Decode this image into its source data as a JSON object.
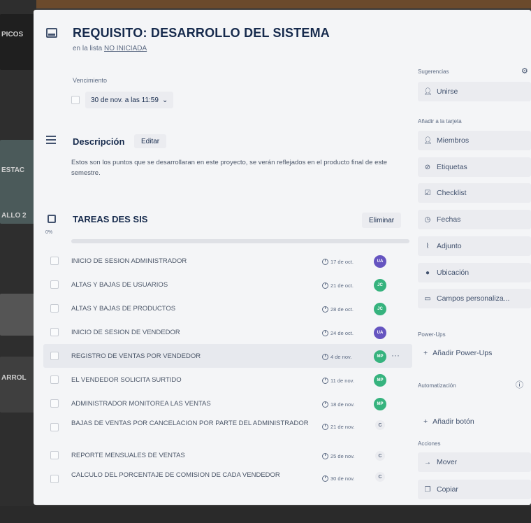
{
  "background": {
    "left_labels": [
      "PICOS",
      "ESTAC",
      "ALLO 2",
      "ARROL"
    ]
  },
  "card": {
    "title": "REQUISITO: DESARROLLO DEL SISTEMA",
    "in_list_prefix": "en la lista",
    "list_name": "NO INICIADA"
  },
  "due": {
    "label": "Vencimiento",
    "value": "30 de nov. a las 11:59",
    "chevron": "⌄"
  },
  "description": {
    "title": "Descripción",
    "edit_label": "Editar",
    "text": "Estos son los puntos que se desarrollaran en este proyecto, se verán reflejados en el producto final de este semestre."
  },
  "checklist": {
    "title": "TAREAS DES SIS",
    "delete_label": "Eliminar",
    "percent": "0%",
    "progress": 0,
    "items": [
      {
        "text": "INICIO DE SESION ADMINISTRADOR",
        "date": "17 de oct.",
        "avatar": "UA",
        "avatar_color": "#6554c0"
      },
      {
        "text": "ALTAS Y BAJAS DE USUARIOS",
        "date": "21 de oct.",
        "avatar": "JC",
        "avatar_color": "#36b37e"
      },
      {
        "text": "ALTAS Y BAJAS DE PRODUCTOS",
        "date": "28 de oct.",
        "avatar": "JC",
        "avatar_color": "#36b37e"
      },
      {
        "text": "INICIO DE SESION DE VENDEDOR",
        "date": "24 de oct.",
        "avatar": "UA",
        "avatar_color": "#6554c0"
      },
      {
        "text": "REGISTRO DE VENTAS POR VENDEDOR",
        "date": "4 de nov.",
        "avatar": "MP",
        "avatar_color": "#36b37e",
        "more": "···"
      },
      {
        "text": "EL VENDEDOR SOLICITA SURTIDO",
        "date": "11 de nov.",
        "avatar": "MP",
        "avatar_color": "#36b37e"
      },
      {
        "text": "ADMINISTRADOR MONITOREA LAS VENTAS",
        "date": "18 de nov.",
        "avatar": "MP",
        "avatar_color": "#36b37e"
      },
      {
        "text": "BAJAS DE VENTAS POR CANCELACION POR PARTE DEL ADMINISTRADOR",
        "date": "21 de nov.",
        "avatar": "C"
      },
      {
        "text": "REPORTE MENSUALES DE VENTAS",
        "date": "25 de nov.",
        "avatar": "C"
      },
      {
        "text": "CALCULO DEL PORCENTAJE DE COMISION DE CADA VENDEDOR",
        "date": "30 de nov.",
        "avatar": "C"
      }
    ]
  },
  "sidebar": {
    "suggestions_label": "Sugerencias",
    "join_label": "Unirse",
    "add_to_card_label": "Añadir a la tarjeta",
    "members_label": "Miembros",
    "labels_label": "Etiquetas",
    "checklist_label": "Checklist",
    "dates_label": "Fechas",
    "attachment_label": "Adjunto",
    "location_label": "Ubicación",
    "custom_fields_label": "Campos personaliza...",
    "powerups_section": "Power-Ups",
    "add_powerups_label": "Añadir Power-Ups",
    "automation_section": "Automatización",
    "add_button_label": "Añadir botón",
    "actions_section": "Acciones",
    "move_label": "Mover",
    "copy_label": "Copiar"
  }
}
